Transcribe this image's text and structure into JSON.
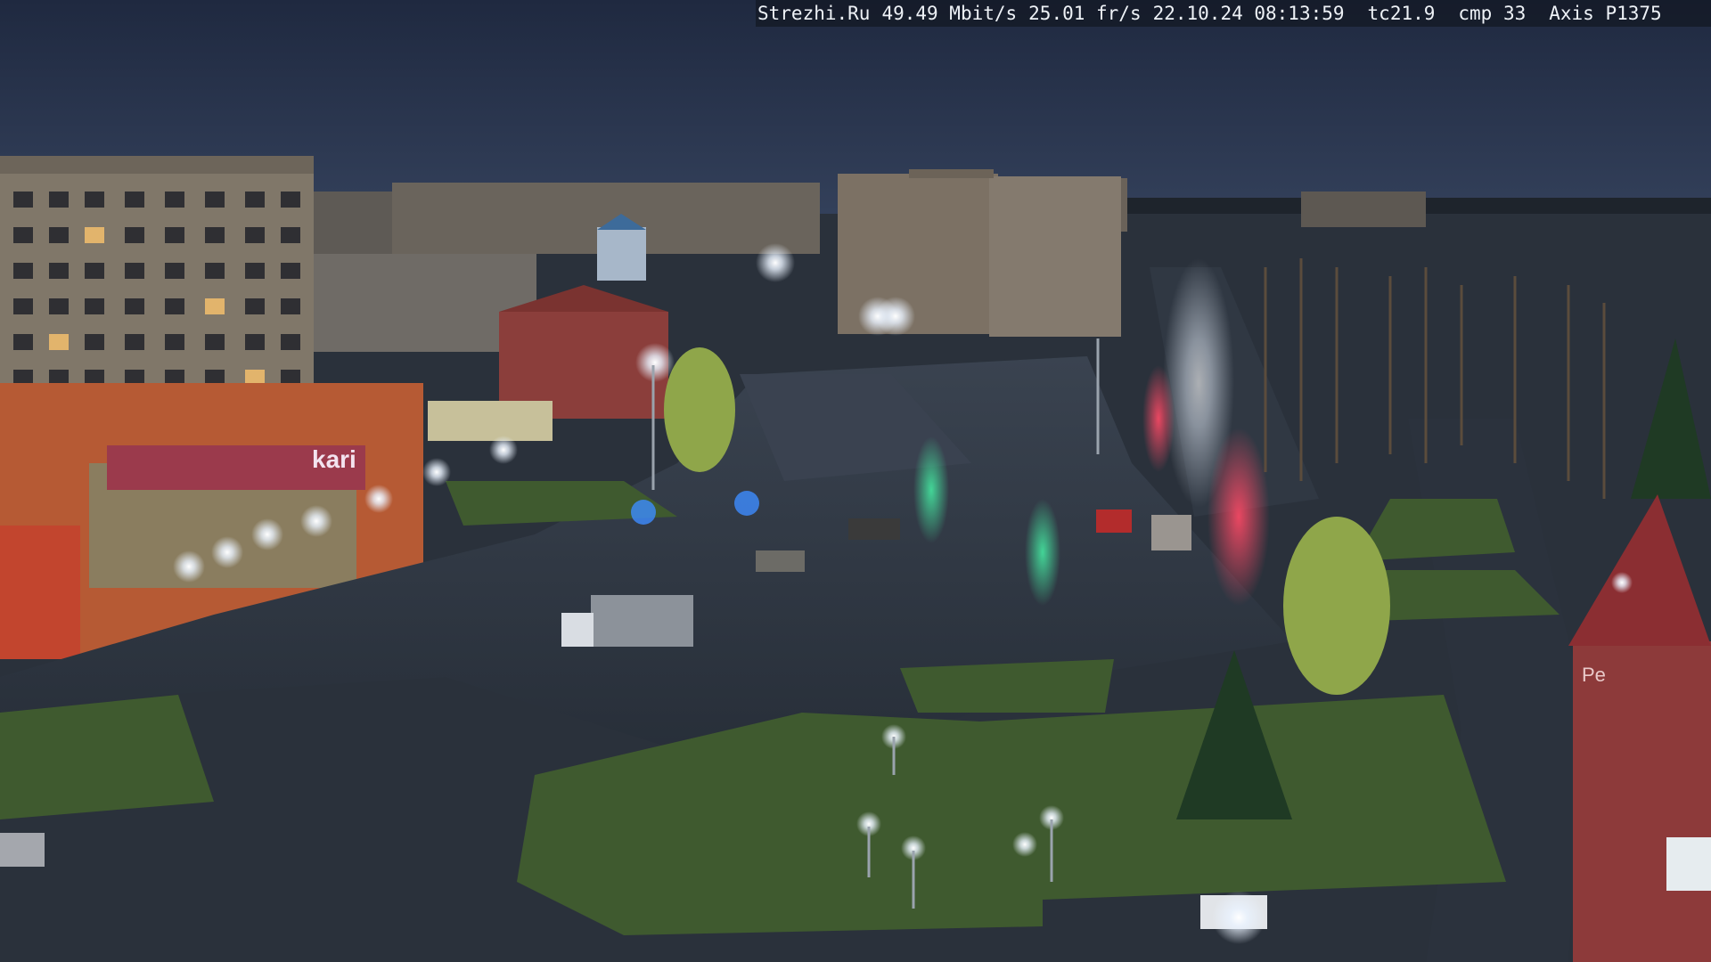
{
  "camera_overlay": {
    "site": "Strezhi.Ru",
    "bitrate": "49.49 Mbit/s",
    "framerate": "25.01 fr/s",
    "datetime": "22.10.24 08:13:59",
    "temperature": "tc21.9",
    "compression": "cmp 33",
    "camera_model": "Axis P1375"
  },
  "signage": {
    "store_sign": "kari",
    "street_sign": "Pe"
  },
  "colors": {
    "sky": "#27334a",
    "road": "#2c3440",
    "grass": "#3f5a2f",
    "building_orange": "#b65a34",
    "building_grey": "#7b7468",
    "building_red": "#8d3a3a",
    "lamp_light": "#e9f2ff",
    "traffic_red": "#ff4057",
    "traffic_green": "#46e39a"
  },
  "scene": {
    "description_tags": [
      "night city square",
      "wet road",
      "street lamps",
      "apartment blocks",
      "trees",
      "truck",
      "cars"
    ]
  }
}
